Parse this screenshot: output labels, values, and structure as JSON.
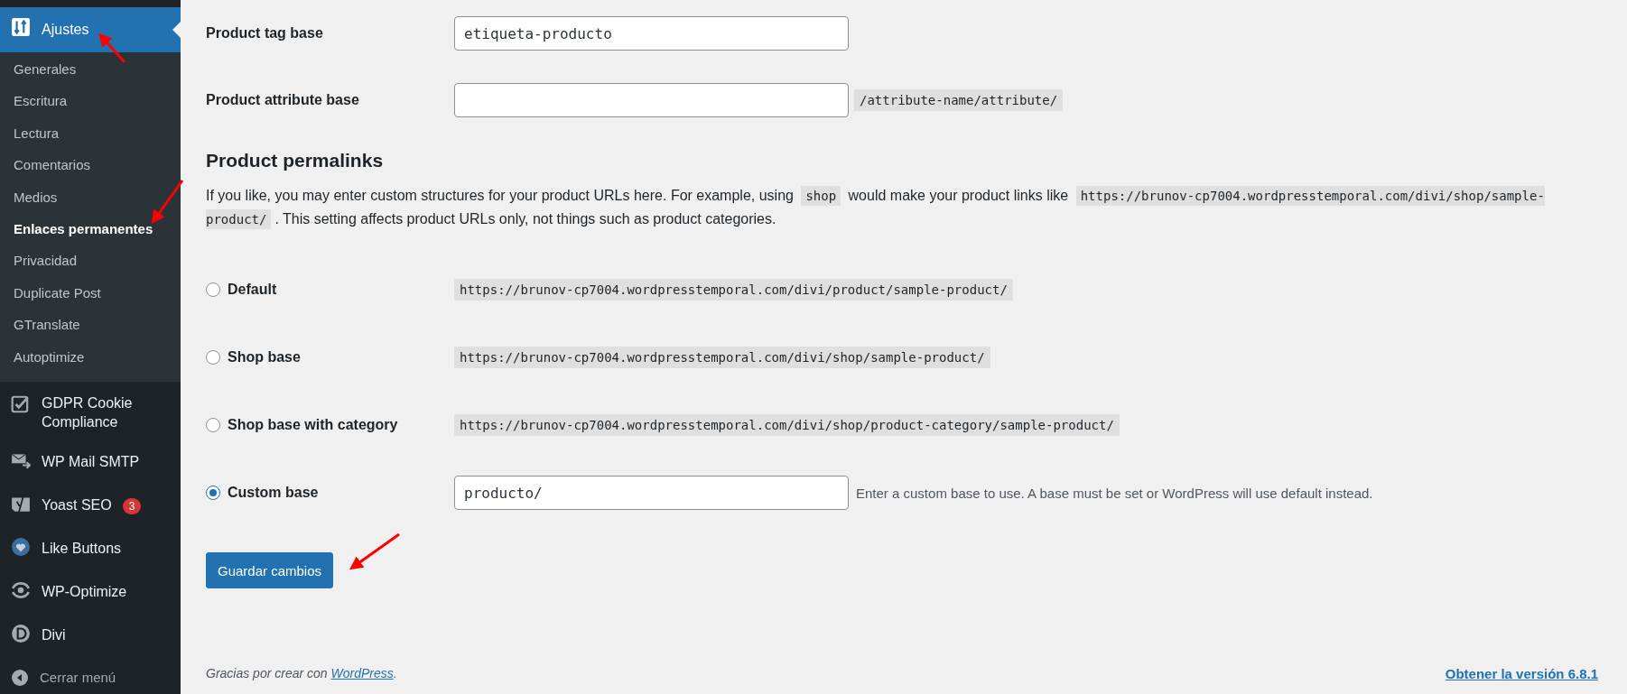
{
  "sidebar": {
    "items": [
      {
        "label": "Ajustes",
        "selected": true,
        "children": [
          {
            "label": "Generales",
            "selected": false
          },
          {
            "label": "Escritura",
            "selected": false
          },
          {
            "label": "Lectura",
            "selected": false
          },
          {
            "label": "Comentarios",
            "selected": false
          },
          {
            "label": "Medios",
            "selected": false
          },
          {
            "label": "Enlaces permanentes",
            "selected": true
          },
          {
            "label": "Privacidad",
            "selected": false
          },
          {
            "label": "Duplicate Post",
            "selected": false
          },
          {
            "label": "GTranslate",
            "selected": false
          },
          {
            "label": "Autoptimize",
            "selected": false
          }
        ]
      },
      {
        "label": "GDPR Cookie Compliance",
        "selected": false
      },
      {
        "label": "WP Mail SMTP",
        "selected": false
      },
      {
        "label": "Yoast SEO",
        "selected": false,
        "badge": "3"
      },
      {
        "label": "Like Buttons",
        "selected": false
      },
      {
        "label": "WP-Optimize",
        "selected": false
      },
      {
        "label": "Divi",
        "selected": false
      }
    ],
    "collapse": "Cerrar menú"
  },
  "fields": [
    {
      "label": "Product tag base",
      "value": "etiqueta-producto"
    },
    {
      "label": "Product attribute base",
      "hint": "/attribute-name/attribute/"
    }
  ],
  "section": {
    "heading": "Product permalinks",
    "description": [
      {
        "kind": "text",
        "text": "If you like, you may enter custom structures for your product URLs here. For example, using "
      },
      {
        "kind": "code",
        "text": "shop"
      },
      {
        "kind": "text",
        "text": " would make your product links like "
      },
      {
        "kind": "code",
        "text": "https://brunov-cp7004.wordpresstemporal.com/divi/shop/sample-product/"
      },
      {
        "kind": "text",
        "text": ". This setting affects product URLs only, not things such as product categories."
      }
    ]
  },
  "options": [
    {
      "kind": "example",
      "label": "Default",
      "selected": false,
      "example": "https://brunov-cp7004.wordpresstemporal.com/divi/product/sample-product/"
    },
    {
      "kind": "example",
      "label": "Shop base",
      "selected": false,
      "example": "https://brunov-cp7004.wordpresstemporal.com/divi/shop/sample-product/"
    },
    {
      "kind": "example",
      "label": "Shop base with category",
      "selected": false,
      "example": "https://brunov-cp7004.wordpresstemporal.com/divi/shop/product-category/sample-product/"
    },
    {
      "kind": "input",
      "label": "Custom base",
      "selected": true,
      "value": "producto/",
      "note": "Enter a custom base to use. A base must be set or WordPress will use default instead."
    }
  ],
  "save_button": "Guardar cambios",
  "footer": {
    "thanks": "Gracias por crear con ",
    "link": "WordPress",
    "after": ".",
    "version": "Obtener la versión 6.8.1"
  }
}
